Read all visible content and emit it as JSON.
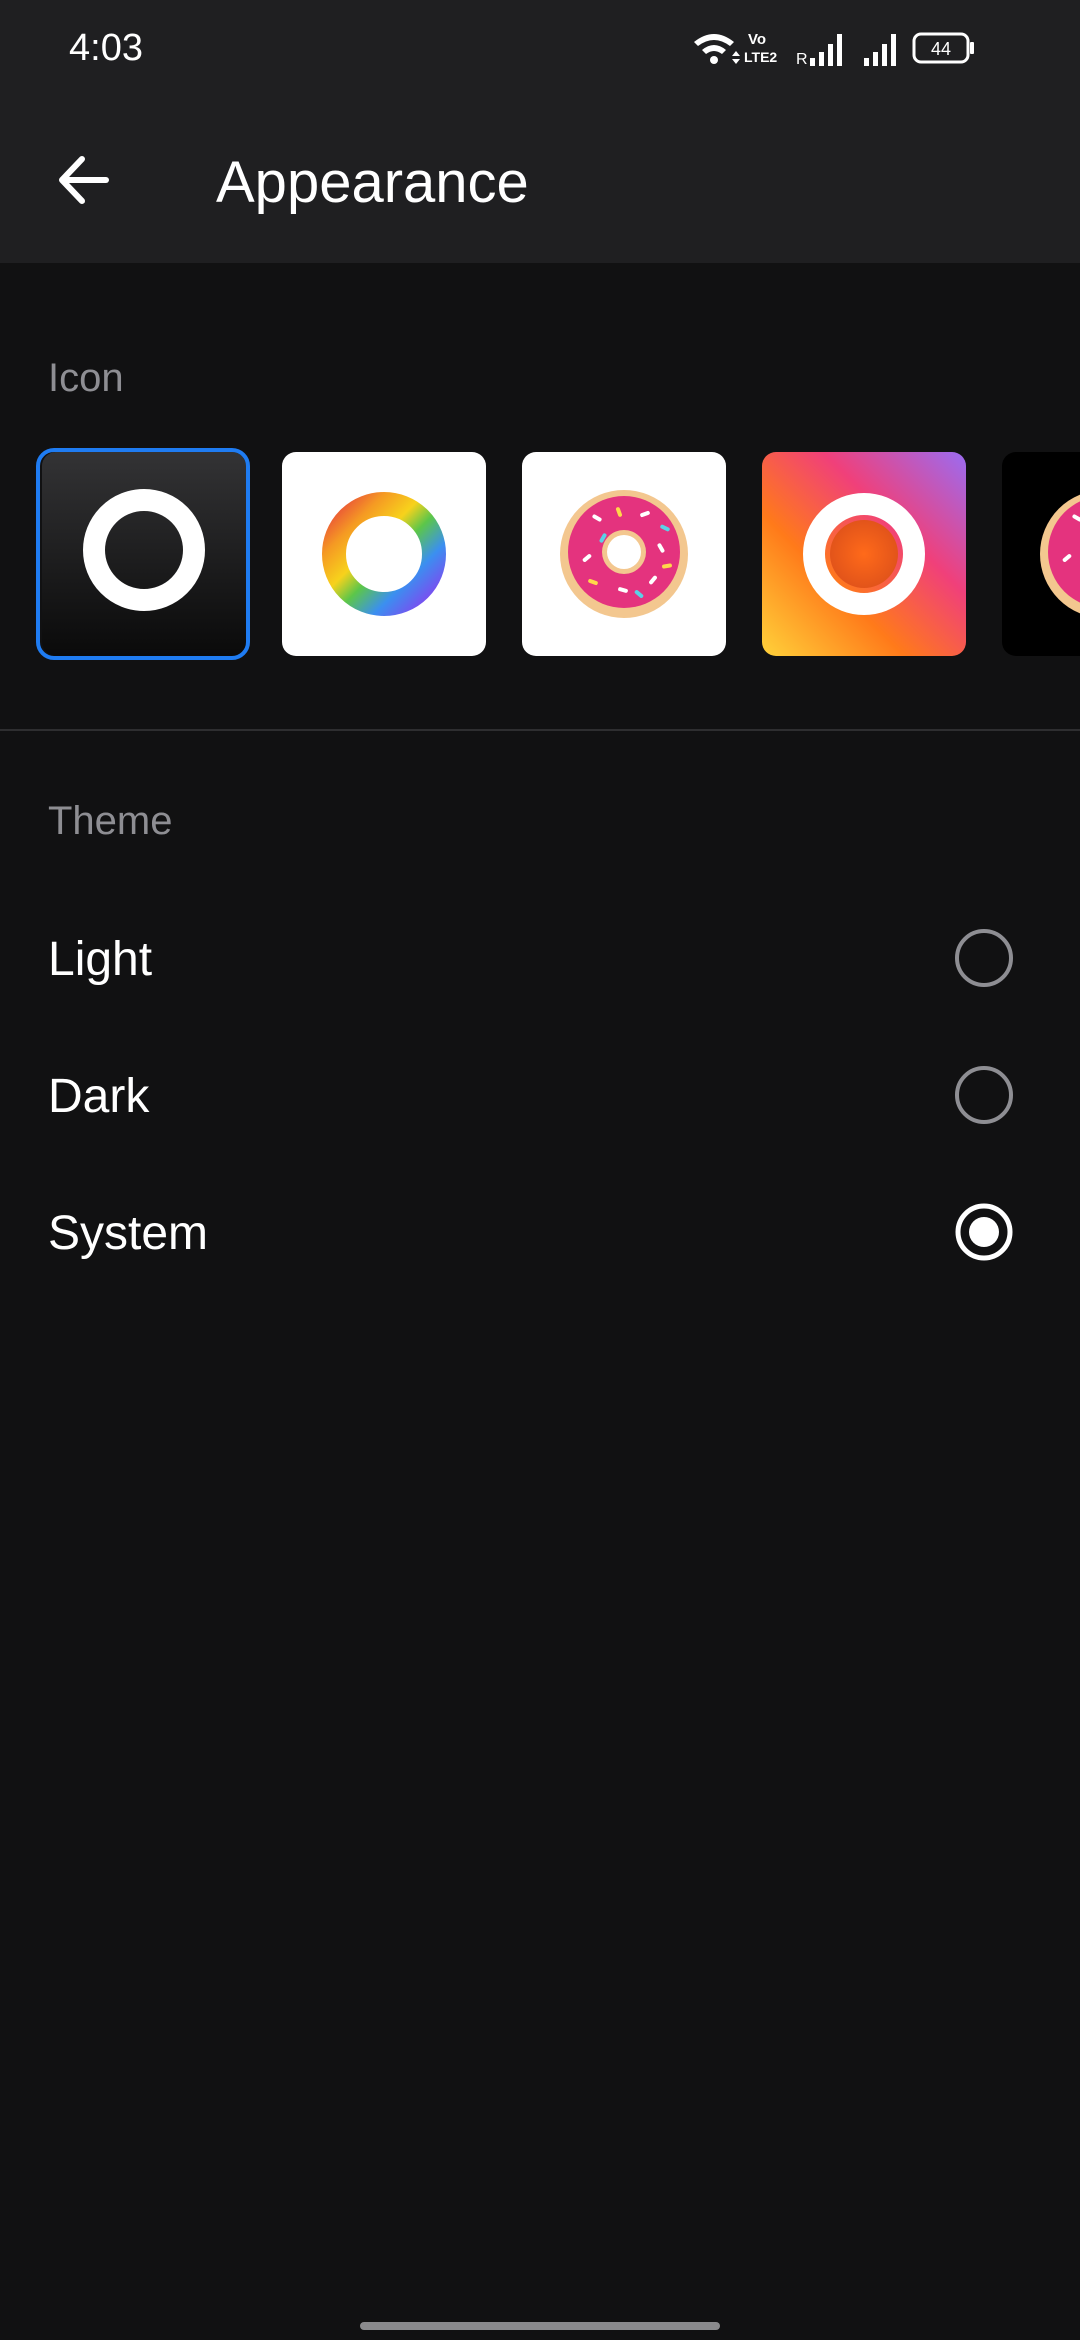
{
  "status_bar": {
    "time": "4:03",
    "battery": "44",
    "network_label_top": "Vo",
    "network_label_bottom": "LTE2",
    "roaming": "R"
  },
  "header": {
    "title": "Appearance",
    "back_icon": "arrow-left-icon"
  },
  "icon_section": {
    "label": "Icon",
    "icons": [
      {
        "name": "black-ring",
        "selected": true
      },
      {
        "name": "rainbow-ring",
        "selected": false
      },
      {
        "name": "pink-donut",
        "selected": false
      },
      {
        "name": "gradient-ring",
        "selected": false
      },
      {
        "name": "black-donut",
        "selected": false
      }
    ]
  },
  "theme_section": {
    "label": "Theme",
    "options": [
      {
        "label": "Light",
        "selected": false
      },
      {
        "label": "Dark",
        "selected": false
      },
      {
        "label": "System",
        "selected": true
      }
    ]
  },
  "colors": {
    "background": "#111112",
    "app_bar": "#1f1f21",
    "accent": "#1f7cf2",
    "section_label": "#8e8e93"
  }
}
